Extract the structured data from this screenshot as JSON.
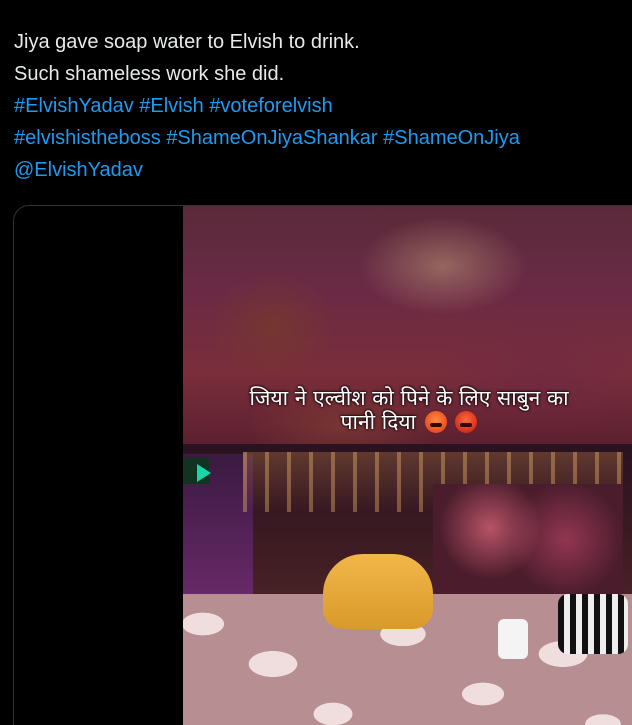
{
  "tweet": {
    "line1": "Jiya gave soap water to Elvish to drink.",
    "line2": "Such shameless work she did.",
    "hashtags_line1": [
      "#ElvishYadav",
      "#Elvish",
      "#voteforelvish"
    ],
    "hashtags_line2": [
      "#elvishistheboss",
      "#ShameOnJiyaShankar",
      "#ShameOnJiya"
    ],
    "mention": "@ElvishYadav"
  },
  "video": {
    "caption_line1": "जिया ने एल्वीश को पिने के लिए साबुन का",
    "caption_line2": "पानी दिया",
    "caption_emojis": [
      "angry-face",
      "face-with-symbols-on-mouth"
    ]
  },
  "colors": {
    "text": "#e7e9ea",
    "link": "#1d9bf0",
    "background": "#000000",
    "border": "#2f3336"
  }
}
